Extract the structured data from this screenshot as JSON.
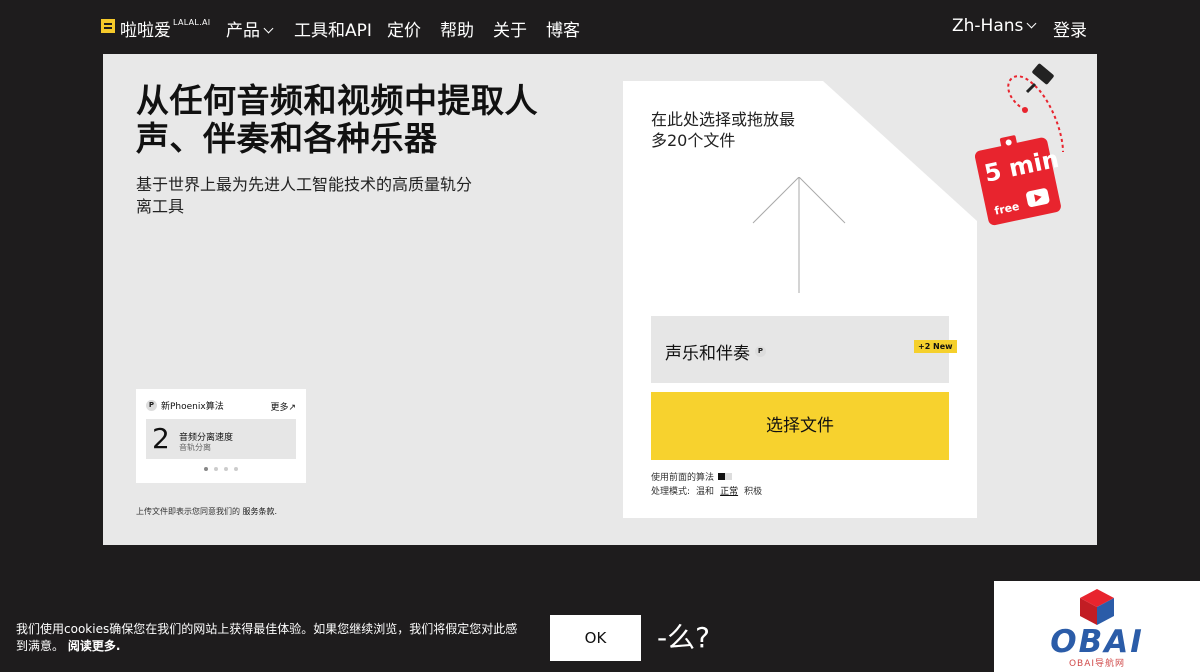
{
  "nav": {
    "logo_text": "啦啦爱",
    "logo_sup": "LALAL.AI",
    "items": [
      "产品",
      "工具和API",
      "定价",
      "帮助",
      "关于",
      "博客"
    ],
    "language": "Zh-Hans",
    "login": "登录"
  },
  "hero": {
    "title": "从任何音频和视频中提取人声、伴奏和各种乐器",
    "subtitle": "基于世界上最为先进人工智能技术的高质量轨分离工具"
  },
  "phoenix": {
    "icon": "P",
    "title": "新Phoenix算法",
    "more": "更多↗",
    "number": "2",
    "line1": "音频分离速度",
    "line2": "音轨分离"
  },
  "terms": {
    "prefix": "上传文件即表示您同意我们的 ",
    "link": "服务条款."
  },
  "upload": {
    "drop_text": "在此处选择或拖放最多20个文件",
    "select_value": "声乐和伴奏",
    "select_icon": "P",
    "new_badge": "+2 New",
    "choose_button": "选择文件",
    "algo_label": "使用前面的算法",
    "mode_label": "处理模式:",
    "modes": [
      "温和",
      "正常",
      "积极"
    ]
  },
  "sticker": {
    "label": "5 min",
    "sub": "free"
  },
  "cookie": {
    "text": "我们使用cookies确保您在我们的网站上获得最佳体验。如果您继续浏览，我们将假定您对此感到满意。",
    "link": "阅读更多.",
    "ok": "OK",
    "extra": "-么?"
  },
  "watermark": {
    "text": "OBAI",
    "sub": "OBAI导航网"
  },
  "colors": {
    "background": "#1e1c1d",
    "accent_yellow": "#f7d22e",
    "sticker_red": "#e8242e",
    "card_gray": "#e8e8e8"
  }
}
